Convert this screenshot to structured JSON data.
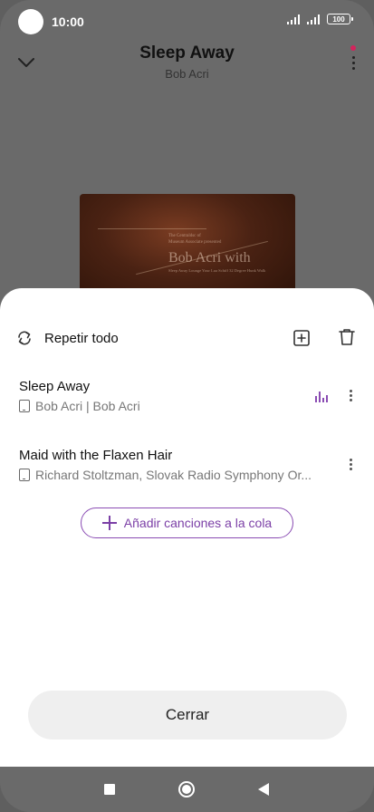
{
  "status_bar": {
    "time": "10:00",
    "battery": "100",
    "icons": [
      "signal-icon",
      "signal-icon",
      "battery-icon"
    ]
  },
  "player": {
    "title": "Sleep Away",
    "artist": "Bob Acri",
    "album_art_text": {
      "top_line_1": "The Centraldsc of",
      "top_line_2": "Museum Associate presented",
      "big": "Bob Acri with",
      "bottom": "Sleep Away  Lounge Your Lua Schiff 32 Degree Hunk Walk"
    }
  },
  "queue_sheet": {
    "repeat_label": "Repetir todo",
    "tracks": [
      {
        "title": "Sleep Away",
        "subtitle": "Bob Acri | Bob Acri",
        "playing": true
      },
      {
        "title": "Maid with the Flaxen Hair",
        "subtitle": "Richard Stoltzman, Slovak Radio Symphony Or...",
        "playing": false
      }
    ],
    "add_songs_label": "Añadir canciones a la cola",
    "close_label": "Cerrar"
  },
  "colors": {
    "accent": "#7b3fa6",
    "overlay": "#6a6a6a",
    "notification_dot": "#d4235c"
  }
}
